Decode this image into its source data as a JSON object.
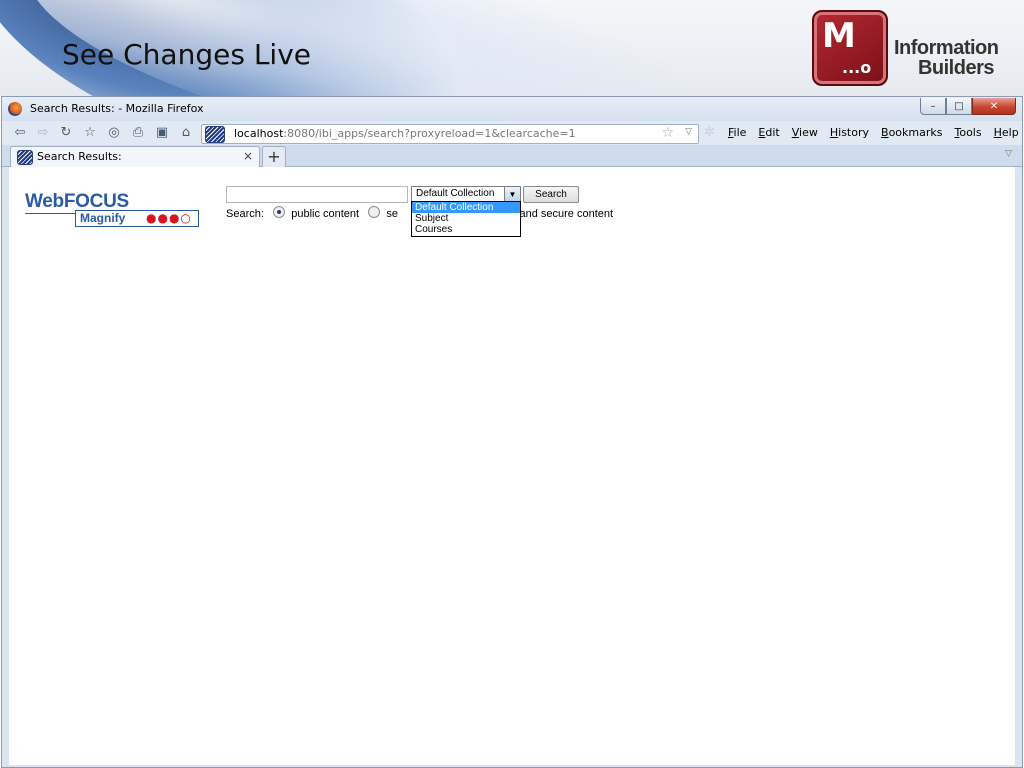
{
  "slide": {
    "title": "See Changes Live",
    "logo_letter": "M",
    "logo_dots": "...o",
    "brand_line1": "Information",
    "brand_line2": "Builders"
  },
  "window": {
    "title": "Search Results: - Mozilla Firefox",
    "controls": {
      "minimize": "–",
      "maximize": "□",
      "close": "✕"
    }
  },
  "toolbar": {
    "url_host": "localhost",
    "url_rest": ":8080/ibi_apps/search?proxyreload=1&clearcache=1",
    "menus": [
      "File",
      "Edit",
      "View",
      "History",
      "Bookmarks",
      "Tools",
      "Help"
    ]
  },
  "tabs": [
    {
      "label": "Search Results:",
      "active": true
    }
  ],
  "page": {
    "logo_word": "WebFOCUS",
    "logo_magnify": "Magnify",
    "logo_dots": "●●●○",
    "search_value": "",
    "collection_selected": "Default Collection",
    "collection_options": [
      "Default Collection",
      "Subject",
      "Courses"
    ],
    "search_button": "Search",
    "search_label": "Search:",
    "radio_options": [
      {
        "label": "public content",
        "checked": true
      },
      {
        "label": "se",
        "checked": false
      },
      {
        "label": "lic and secure content",
        "checked": false
      }
    ]
  }
}
